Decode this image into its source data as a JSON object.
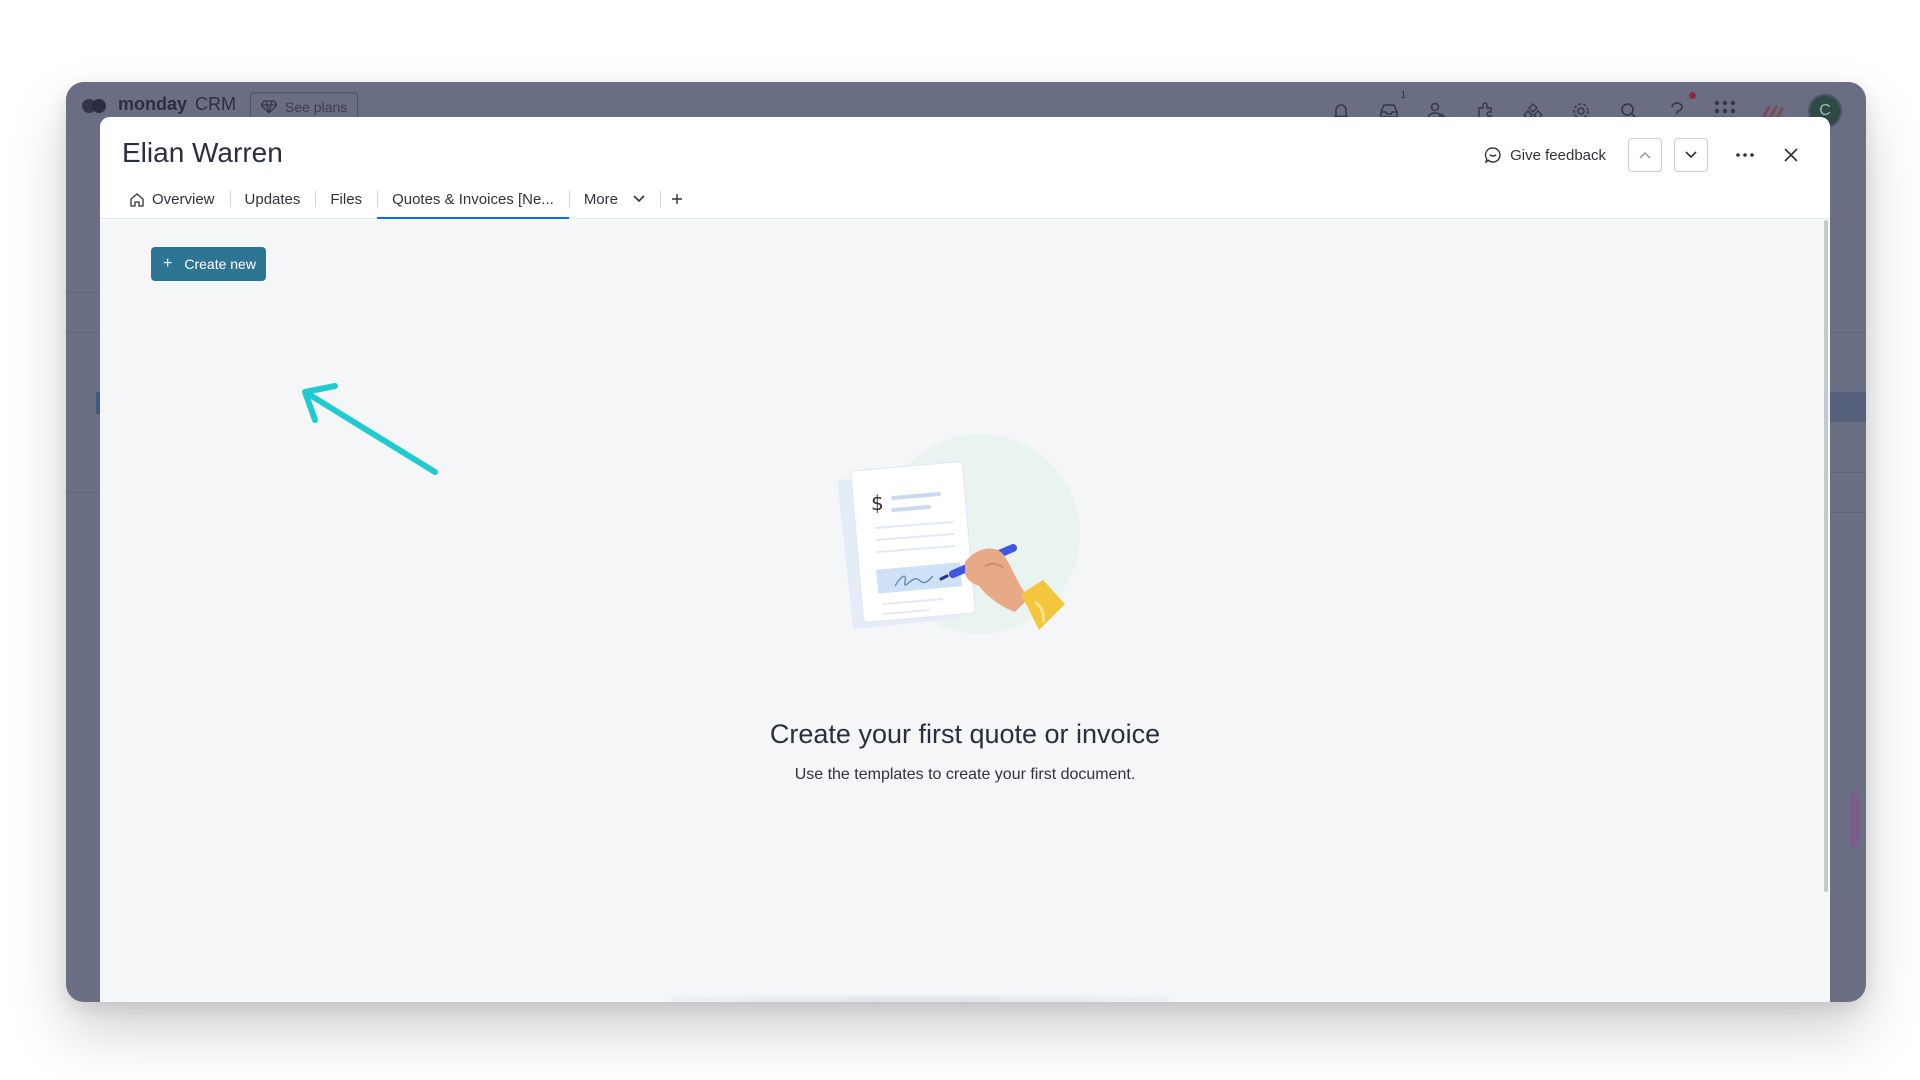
{
  "app": {
    "brand": "monday",
    "product": "CRM",
    "see_plans": "See plans",
    "inbox_badge": "1",
    "avatar_initial": "C"
  },
  "item": {
    "title": "Elian Warren"
  },
  "header": {
    "feedback_label": "Give feedback"
  },
  "tabs": [
    {
      "label": "Overview",
      "icon": "home-icon"
    },
    {
      "label": "Updates"
    },
    {
      "label": "Files"
    },
    {
      "label": "Quotes & Invoices [Ne...",
      "active": true
    },
    {
      "label": "More",
      "icon": "chevron-down-icon"
    }
  ],
  "body": {
    "create_label": "Create new",
    "empty_title": "Create your first quote or invoice",
    "empty_subtitle": "Use the templates to create your first document.",
    "illustration_symbol": "$"
  },
  "colors": {
    "primary_button": "#2e7594",
    "active_tab_underline": "#0073ea",
    "annotation_arrow": "#1fcbd0"
  }
}
